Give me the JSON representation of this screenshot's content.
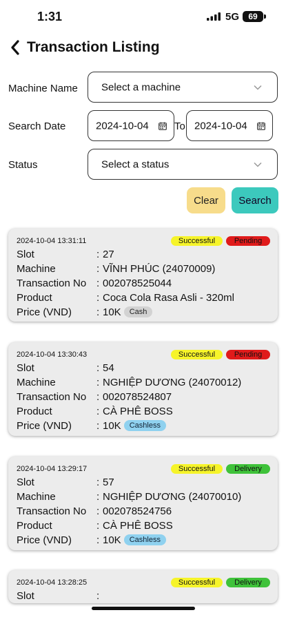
{
  "status_bar": {
    "time": "1:31",
    "network": "5G",
    "battery": "69"
  },
  "header": {
    "title": "Transaction Listing"
  },
  "form": {
    "machine_label": "Machine Name",
    "machine_placeholder": "Select a machine",
    "date_label": "Search Date",
    "date_from": "2024-10-04",
    "to_label": "To",
    "date_to": "2024-10-04",
    "status_label": "Status",
    "status_placeholder": "Select a status",
    "clear_label": "Clear",
    "search_label": "Search"
  },
  "field_labels": {
    "slot": "Slot",
    "machine": "Machine",
    "transaction_no": "Transaction No",
    "product": "Product",
    "price": "Price (VND)"
  },
  "transactions": [
    {
      "datetime": "2024-10-04 13:31:11",
      "status": "Successful",
      "stage": "Pending",
      "slot": "27",
      "machine": "VĨNH PHÚC (24070009)",
      "transaction_no": "002078525044",
      "product": "Coca Cola Rasa Asli - 320ml",
      "price": "10K",
      "payment": "Cash"
    },
    {
      "datetime": "2024-10-04 13:30:43",
      "status": "Successful",
      "stage": "Pending",
      "slot": "54",
      "machine": "NGHIỆP DƯƠNG (24070012)",
      "transaction_no": "002078524807",
      "product": "CÀ PHÊ BOSS",
      "price": "10K",
      "payment": "Cashless"
    },
    {
      "datetime": "2024-10-04 13:29:17",
      "status": "Successful",
      "stage": "Delivery",
      "slot": "57",
      "machine": "NGHIỆP DƯƠNG (24070010)",
      "transaction_no": "002078524756",
      "product": "CÀ PHÊ BOSS",
      "price": "10K",
      "payment": "Cashless"
    },
    {
      "datetime": "2024-10-04 13:28:25",
      "status": "Successful",
      "stage": "Delivery"
    }
  ],
  "colors": {
    "clear_button": "#f7dc8b",
    "search_button": "#3cc9bd",
    "successful": "#f6f42a",
    "pending": "#e01b1b",
    "delivery": "#3fc23a",
    "cash": "#d2d2d2",
    "cashless": "#8fd1ef"
  }
}
